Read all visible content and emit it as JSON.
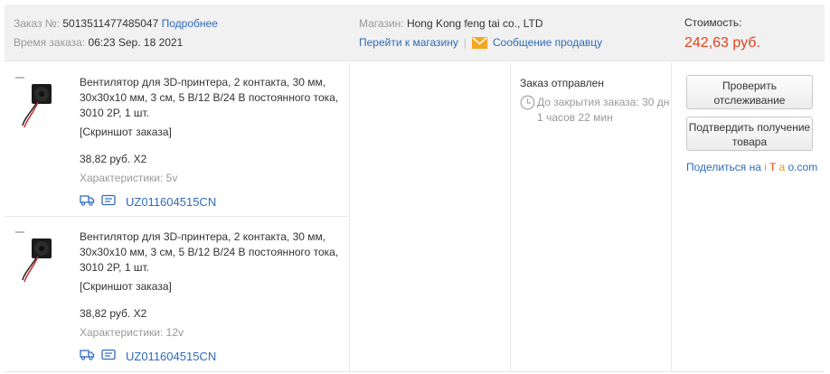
{
  "header": {
    "order_no_label": "Заказ №:",
    "order_no": "5013511477485047",
    "details_link": "Подробнее",
    "order_time_label": "Время заказа:",
    "order_time": "06:23 Sep. 18 2021",
    "store_label": "Магазин:",
    "store_name": "Hong Kong feng tai co., LTD",
    "goto_store": "Перейти к магазину",
    "separator": "|",
    "message_seller": "Сообщение продавцу",
    "cost_label": "Стоимость:",
    "cost_value": "242,63 руб."
  },
  "items": [
    {
      "title": "Вентилятор для 3D-принтера, 2 контакта, 30 мм, 30x30x10 мм, 3 см, 5 В/12 В/24 В постоянного тока, 3010 2P, 1 шт.",
      "snapshot": "[Скриншот заказа]",
      "price_qty": "38,82 руб. X2",
      "attr": "Характеристики: 5v",
      "tracking": "UZ011604515CN"
    },
    {
      "title": "Вентилятор для 3D-принтера, 2 контакта, 30 мм, 30x30x10 мм, 3 см, 5 В/12 В/24 В постоянного тока, 3010 2P, 1 шт.",
      "snapshot": "[Скриншот заказа]",
      "price_qty": "38,82 руб. X2",
      "attr": "Характеристики: 12v",
      "tracking": "UZ011604515CN"
    }
  ],
  "status": {
    "text": "Заказ отправлен",
    "countdown": "До закрытия заказа: 30 дн 1 часов 22 мин"
  },
  "actions": {
    "check_tracking": "Проверить отслеживание",
    "confirm_receipt": "Подтвердить получение товара",
    "share_prefix": "Поделиться на",
    "share_brand": [
      "i",
      "T",
      "a",
      "o.com"
    ]
  },
  "colors": {
    "link": "#2e6bbd",
    "price": "#e0431d",
    "header_bg": "#f1f1f1"
  }
}
